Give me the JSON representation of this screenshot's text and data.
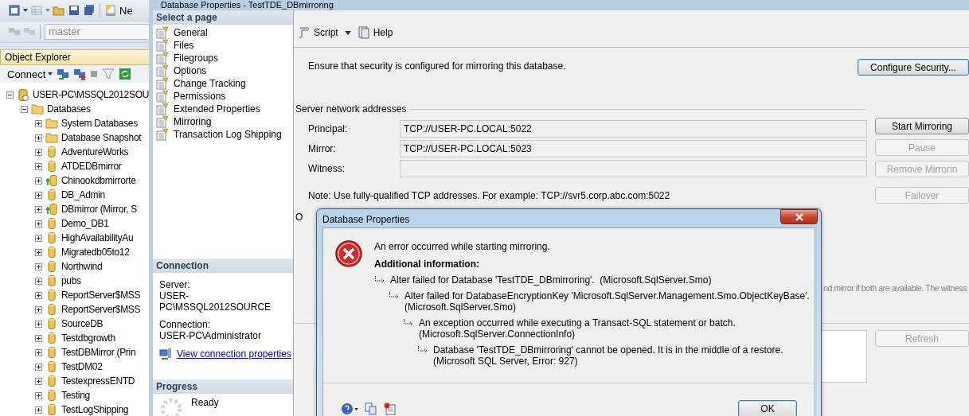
{
  "ssms_toolbar": {
    "new_query_label": "Ne",
    "database_combo": "master"
  },
  "object_explorer": {
    "title": "Object Explorer",
    "connect_label": "Connect",
    "tree": [
      {
        "label": "USER-PC\\MSSQL2012SOU",
        "kind": "server",
        "expanded": true,
        "children": [
          {
            "label": "Databases",
            "kind": "folder",
            "expanded": true,
            "children": [
              {
                "label": "System Databases",
                "kind": "folder",
                "expanded": false
              },
              {
                "label": "Database Snapshot",
                "kind": "folder",
                "expanded": false
              },
              {
                "label": "AdventureWorks",
                "kind": "database",
                "expanded": false
              },
              {
                "label": "ATDEDBmirror",
                "kind": "database",
                "expanded": false
              },
              {
                "label": "Chinookdbmirrorte",
                "kind": "mirrored-database",
                "expanded": false
              },
              {
                "label": "DB_Admin",
                "kind": "database",
                "expanded": false
              },
              {
                "label": "DBmirror (Mirror, S",
                "kind": "mirrored-database",
                "expanded": false
              },
              {
                "label": "Demo_DB1",
                "kind": "database",
                "expanded": false
              },
              {
                "label": "HighAvailabilityAu",
                "kind": "database",
                "expanded": false
              },
              {
                "label": "Migratedb05to12",
                "kind": "database",
                "expanded": false
              },
              {
                "label": "Northwind",
                "kind": "database",
                "expanded": false
              },
              {
                "label": "pubs",
                "kind": "database",
                "expanded": false
              },
              {
                "label": "ReportServer$MSS",
                "kind": "database",
                "expanded": false
              },
              {
                "label": "ReportServer$MSS",
                "kind": "database",
                "expanded": false
              },
              {
                "label": "SourceDB",
                "kind": "database",
                "expanded": false
              },
              {
                "label": "Testdbgrowth",
                "kind": "database",
                "expanded": false
              },
              {
                "label": "TestDBMirror (Prin",
                "kind": "database",
                "expanded": false
              },
              {
                "label": "TestDM02",
                "kind": "database",
                "expanded": false
              },
              {
                "label": "TestexpressENTD",
                "kind": "database",
                "expanded": false
              },
              {
                "label": "Testing",
                "kind": "database",
                "expanded": false
              },
              {
                "label": "TestLogShipping",
                "kind": "database",
                "expanded": false
              }
            ]
          }
        ]
      }
    ]
  },
  "properties_window": {
    "title": "Database Properties - TestTDE_DBmirroring",
    "select_page_header": "Select a page",
    "pages": [
      {
        "label": "General",
        "selected": false
      },
      {
        "label": "Files",
        "selected": false
      },
      {
        "label": "Filegroups",
        "selected": false
      },
      {
        "label": "Options",
        "selected": false
      },
      {
        "label": "Change Tracking",
        "selected": false
      },
      {
        "label": "Permissions",
        "selected": false
      },
      {
        "label": "Extended Properties",
        "selected": false
      },
      {
        "label": "Mirroring",
        "selected": true
      },
      {
        "label": "Transaction Log Shipping",
        "selected": false
      }
    ],
    "connection": {
      "header": "Connection",
      "server_label": "Server:",
      "server": "USER-PC\\MSSQL2012SOURCE",
      "connection_label": "Connection:",
      "connection": "USER-PC\\Administrator",
      "link": "View connection properties"
    },
    "progress": {
      "header": "Progress",
      "status": "Ready"
    },
    "toolbar": {
      "script": "Script",
      "help": "Help"
    },
    "security_text": "Ensure that security is configured for mirroring this database.",
    "configure_button": "Configure Security...",
    "addresses_title": "Server network addresses",
    "addresses": [
      {
        "label": "Principal:",
        "value": "TCP://USER-PC.LOCAL:5022"
      },
      {
        "label": "Mirror:",
        "value": "TCP://USER-PC.LOCAL:5023"
      },
      {
        "label": "Witness:"
      }
    ],
    "mirror_buttons": [
      {
        "label": "Start Mirroring",
        "disabled": false
      },
      {
        "label": "Pause",
        "disabled": true
      },
      {
        "label": "Remove Mirrorin",
        "disabled": true
      }
    ],
    "note": "Note: Use fully-qualified TCP addresses. For example: TCP://svr5.corp.abc.com:5022",
    "failover_button": {
      "label": "Failover",
      "disabled": true
    },
    "operating_mode_fragment": "O",
    "operating_mode_text_fragment": "nd mirror if both are available. The witness",
    "refresh_button": {
      "label": "Refresh",
      "disabled": true
    }
  },
  "dialog": {
    "title": "Database Properties",
    "message": "An error occurred while starting mirroring.",
    "additional_header": "Additional information:",
    "details": [
      {
        "text": "Alter failed for Database 'TestTDE_DBmirroring'.  (Microsoft.SqlServer.Smo)",
        "children": [
          {
            "text": "Alter failed for DatabaseEncryptionKey 'Microsoft.SqlServer.Management.Smo.ObjectKeyBase'.\n(Microsoft.SqlServer.Smo)",
            "children": [
              {
                "text": "An exception occurred while executing a Transact-SQL statement or batch.\n(Microsoft.SqlServer.ConnectionInfo)",
                "children": [
                  {
                    "text": "Database 'TestTDE_DBmirroring' cannot be opened. It is in the middle of a restore.\n(Microsoft SQL Server, Error: 927)"
                  }
                ]
              }
            ]
          }
        ]
      }
    ],
    "ok_button": "OK"
  }
}
